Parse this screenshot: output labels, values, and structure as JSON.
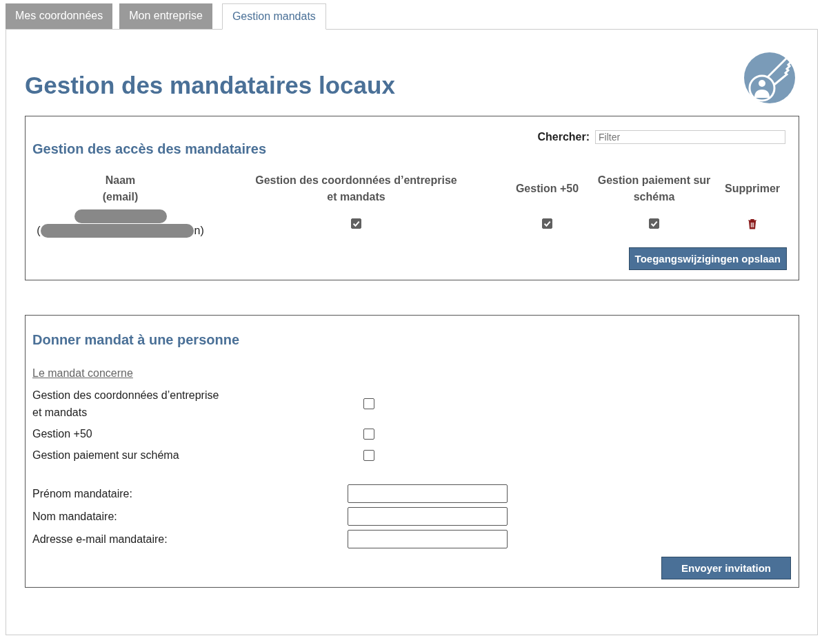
{
  "tabs": [
    {
      "label": "Mes coordonnées",
      "selected": false
    },
    {
      "label": "Mon entreprise",
      "selected": false
    },
    {
      "label": "Gestion mandats",
      "selected": true
    }
  ],
  "title": "Gestion des mandataires locaux",
  "access": {
    "heading": "Gestion des accès des mandataires",
    "search": {
      "label": "Chercher:",
      "placeholder": "Filter"
    },
    "columns": [
      "Naam\n(email)",
      "Gestion des coordonnées d’entreprise\net mandats",
      "Gestion +50",
      "Gestion paiement sur schéma",
      "Supprimer"
    ],
    "rows": [
      {
        "email_open": "(",
        "email_close": "n)",
        "checks": [
          {
            "checked": true
          },
          {
            "checked": true
          },
          {
            "checked": true
          }
        ]
      }
    ],
    "save_button": "Toegangswijzigingen opslaan"
  },
  "invite": {
    "heading": "Donner mandat à une personne",
    "subheading": "Le mandat concerne",
    "options": [
      {
        "label": "Gestion des coordonnées d’entreprise\net mandats",
        "checked": false
      },
      {
        "label": "Gestion +50",
        "checked": false
      },
      {
        "label": "Gestion paiement sur schéma",
        "checked": false
      }
    ],
    "fields": [
      {
        "label": "Prénom mandataire:"
      },
      {
        "label": "Nom mandataire:"
      },
      {
        "label": "Adresse e-mail mandataire:"
      }
    ],
    "button": "Envoyer invitation"
  }
}
